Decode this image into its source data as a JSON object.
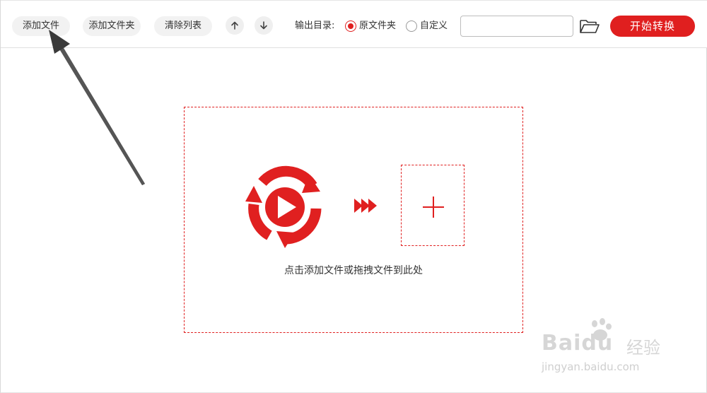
{
  "toolbar": {
    "add_file_label": "添加文件",
    "add_folder_label": "添加文件夹",
    "clear_list_label": "清除列表",
    "move_up_icon": "arrow-up-icon",
    "move_down_icon": "arrow-down-icon",
    "output_dir_label": "输出目录:",
    "output_options": [
      {
        "label": "原文件夹",
        "selected": true
      },
      {
        "label": "自定义",
        "selected": false
      }
    ],
    "path_value": "",
    "folder_icon": "folder-open-icon",
    "start_label": "开始转换"
  },
  "drop_zone": {
    "hint": "点击添加文件或拖拽文件到此处",
    "video_icon": "video-play-icon",
    "arrows_icon": "triple-arrow-icon",
    "add_icon": "plus-icon"
  },
  "annotation": {
    "pointer": "arrow-pointer-icon"
  },
  "watermark": {
    "logo": "Baidu",
    "cn": "经验",
    "url": "jingyan.baidu.com"
  },
  "colors": {
    "accent": "#e01f1f",
    "button_bg": "#f2f2f2",
    "border": "#e0e0e0"
  }
}
